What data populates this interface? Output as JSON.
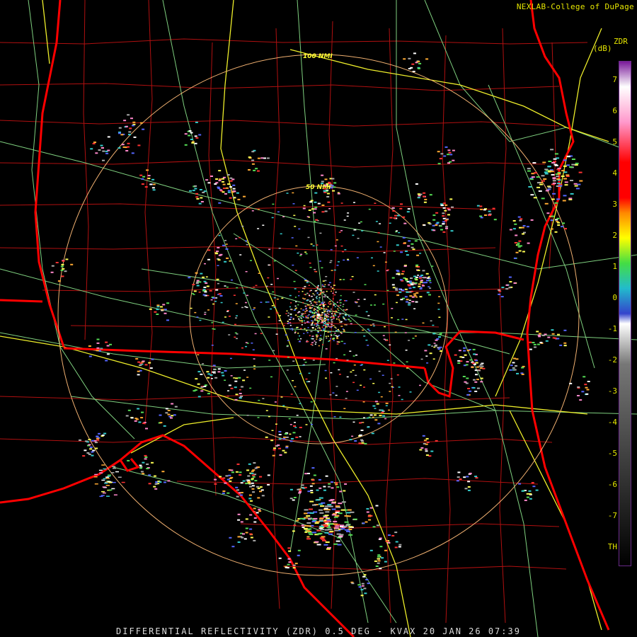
{
  "credit": "NEXLAB-College of DuPage",
  "footer": "DIFFERENTIAL REFLECTIVITY (ZDR) 0.5 DEG - KVAX 20 JAN 26 07:39",
  "legend": {
    "product": "ZDR",
    "unit": "(dB)",
    "ticks": [
      "7",
      "6",
      "5",
      "4",
      "3",
      "2",
      "1",
      "0",
      "-1",
      "-2",
      "-3",
      "-4",
      "-5",
      "-6",
      "-7",
      "TH"
    ],
    "colors": {
      "top": "#7a1a9a",
      "pink": "#ff99cc",
      "red": "#ff0000",
      "orange": "#ff8800",
      "yellow": "#ffff00",
      "green": "#44dd44",
      "cyan": "#22bbcc",
      "blue": "#3344cc",
      "white": "#ffffff",
      "gray": "#777777",
      "black": "#000000"
    }
  },
  "rings": [
    {
      "label": "50 NMI"
    },
    {
      "label": "100 NMI"
    }
  ],
  "map_colors": {
    "state_borders": "#ff0000",
    "county_borders": "#bb1111",
    "highways": "#ffff33",
    "roads": "#88dd88",
    "range_rings": "#ffbb77"
  }
}
